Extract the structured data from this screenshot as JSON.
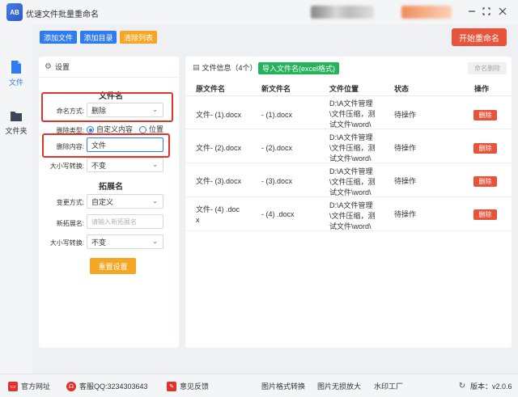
{
  "app": {
    "title": "优速文件批量重命名",
    "logo_text": "AB"
  },
  "sidebar": {
    "items": [
      {
        "label": "文件"
      },
      {
        "label": "文件夹"
      }
    ]
  },
  "toolbar": {
    "add_file": "添加文件",
    "add_dir": "添加目录",
    "clear_list": "清除列表",
    "start_rename": "开始重命名"
  },
  "settings": {
    "header": "设置",
    "filename_section": "文件名",
    "naming_mode_label": "命名方式:",
    "naming_mode_value": "删除",
    "delete_type_label": "删除类型:",
    "delete_type_custom": "自定义内容",
    "delete_type_position": "位置",
    "delete_content_label": "删除内容:",
    "delete_content_value": "文件",
    "case_label": "大小写转换:",
    "case_value": "不变",
    "ext_section": "拓展名",
    "change_mode_label": "变更方式:",
    "change_mode_value": "自定义",
    "new_ext_label": "新拓展名:",
    "new_ext_placeholder": "请输入新拓展名",
    "ext_case_label": "大小写转换:",
    "ext_case_value": "不变",
    "reset_button": "重置设置"
  },
  "files": {
    "header": "文件信息",
    "count": "（4个）",
    "import_button": "导入文件名(excel格式)",
    "delete_rename_button": "命名删除",
    "columns": {
      "original": "原文件名",
      "new": "新文件名",
      "location": "文件位置",
      "status": "状态",
      "action": "操作"
    },
    "rows": [
      {
        "original": "文件- (1).docx",
        "new": "- (1).docx",
        "loc1": "D:\\A文件管理",
        "loc2": "\\文件压缩，测",
        "loc3": "试文件\\word\\",
        "status": "待操作",
        "action": "删除"
      },
      {
        "original": "文件- (2).docx",
        "new": "- (2).docx",
        "loc1": "D:\\A文件管理",
        "loc2": "\\文件压缩，测",
        "loc3": "试文件\\word\\",
        "status": "待操作",
        "action": "删除"
      },
      {
        "original": "文件- (3).docx",
        "new": "- (3).docx",
        "loc1": "D:\\A文件管理",
        "loc2": "\\文件压缩，测",
        "loc3": "试文件\\word\\",
        "status": "待操作",
        "action": "删除"
      },
      {
        "original1": "文件- (4) .doc",
        "original2": "x",
        "new": "- (4) .docx",
        "loc1": "D:\\A文件管理",
        "loc2": "\\文件压缩，测",
        "loc3": "试文件\\word\\",
        "status": "待操作",
        "action": "删除"
      }
    ]
  },
  "footer": {
    "website": "官方网址",
    "qq": "客服QQ:3234303643",
    "feedback": "意见反馈",
    "img_convert": "图片格式转换",
    "img_lossless": "图片无损放大",
    "watermark": "水印工厂",
    "version_label": "版本：",
    "version": "v2.0.6"
  },
  "colors": {
    "primary_blue": "#2f7cf0",
    "orange_red": "#e8543a",
    "green": "#25b35a",
    "yellow": "#f5a623",
    "highlight_red": "#e0332b"
  }
}
